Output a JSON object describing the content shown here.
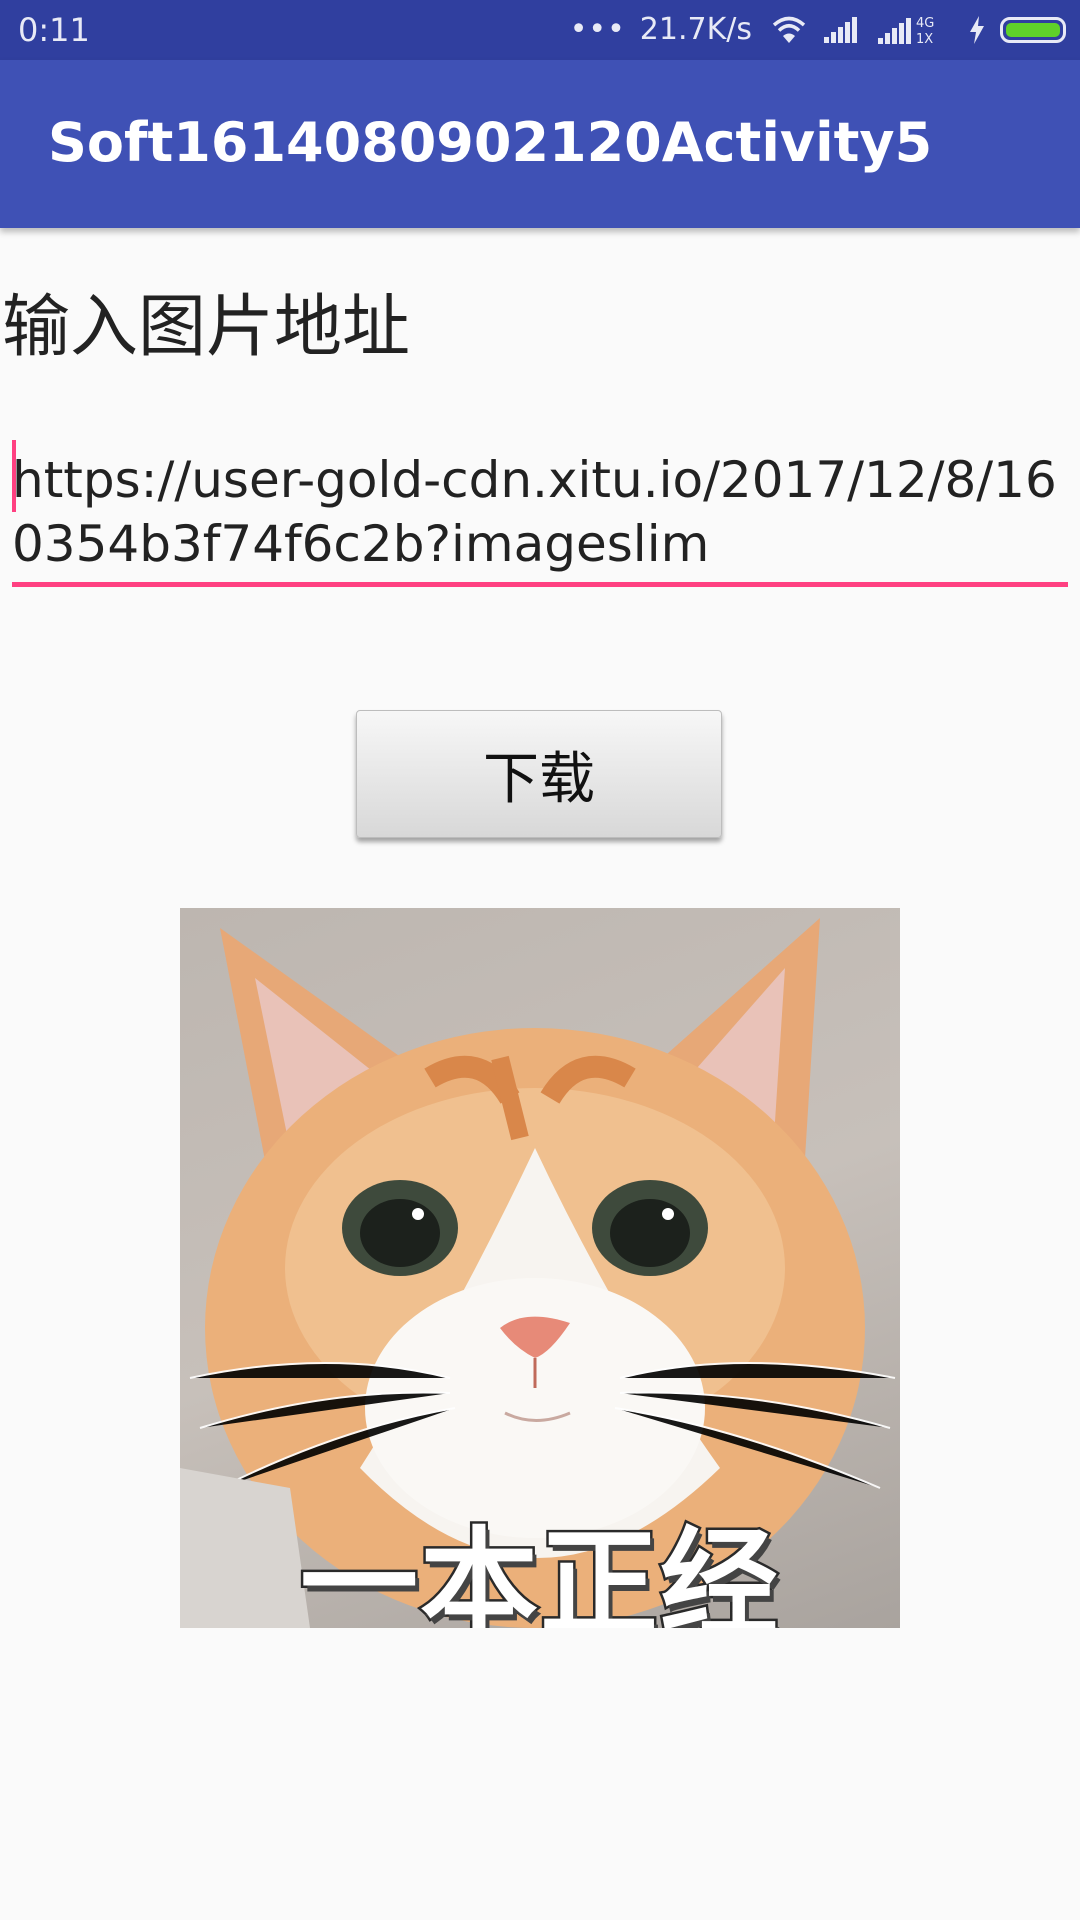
{
  "status_bar": {
    "time": "0:11",
    "dots": "•••",
    "net_speed": "21.7K/s",
    "network_type_top": "4G",
    "network_type_bottom": "1X",
    "battery_level": 1.0,
    "battery_color": "#5fd12a"
  },
  "app_bar": {
    "title": "Soft1614080902120Activity5",
    "color": "#3f51b5"
  },
  "content": {
    "prompt_label": "输入图片地址",
    "url_input_value": "https://user-gold-cdn.xitu.io/2017/12/8/160354b3f74f6c2b?imageslim",
    "accent_color": "#ff4081",
    "download_button_label": "下载",
    "image_caption": "一本正经"
  }
}
